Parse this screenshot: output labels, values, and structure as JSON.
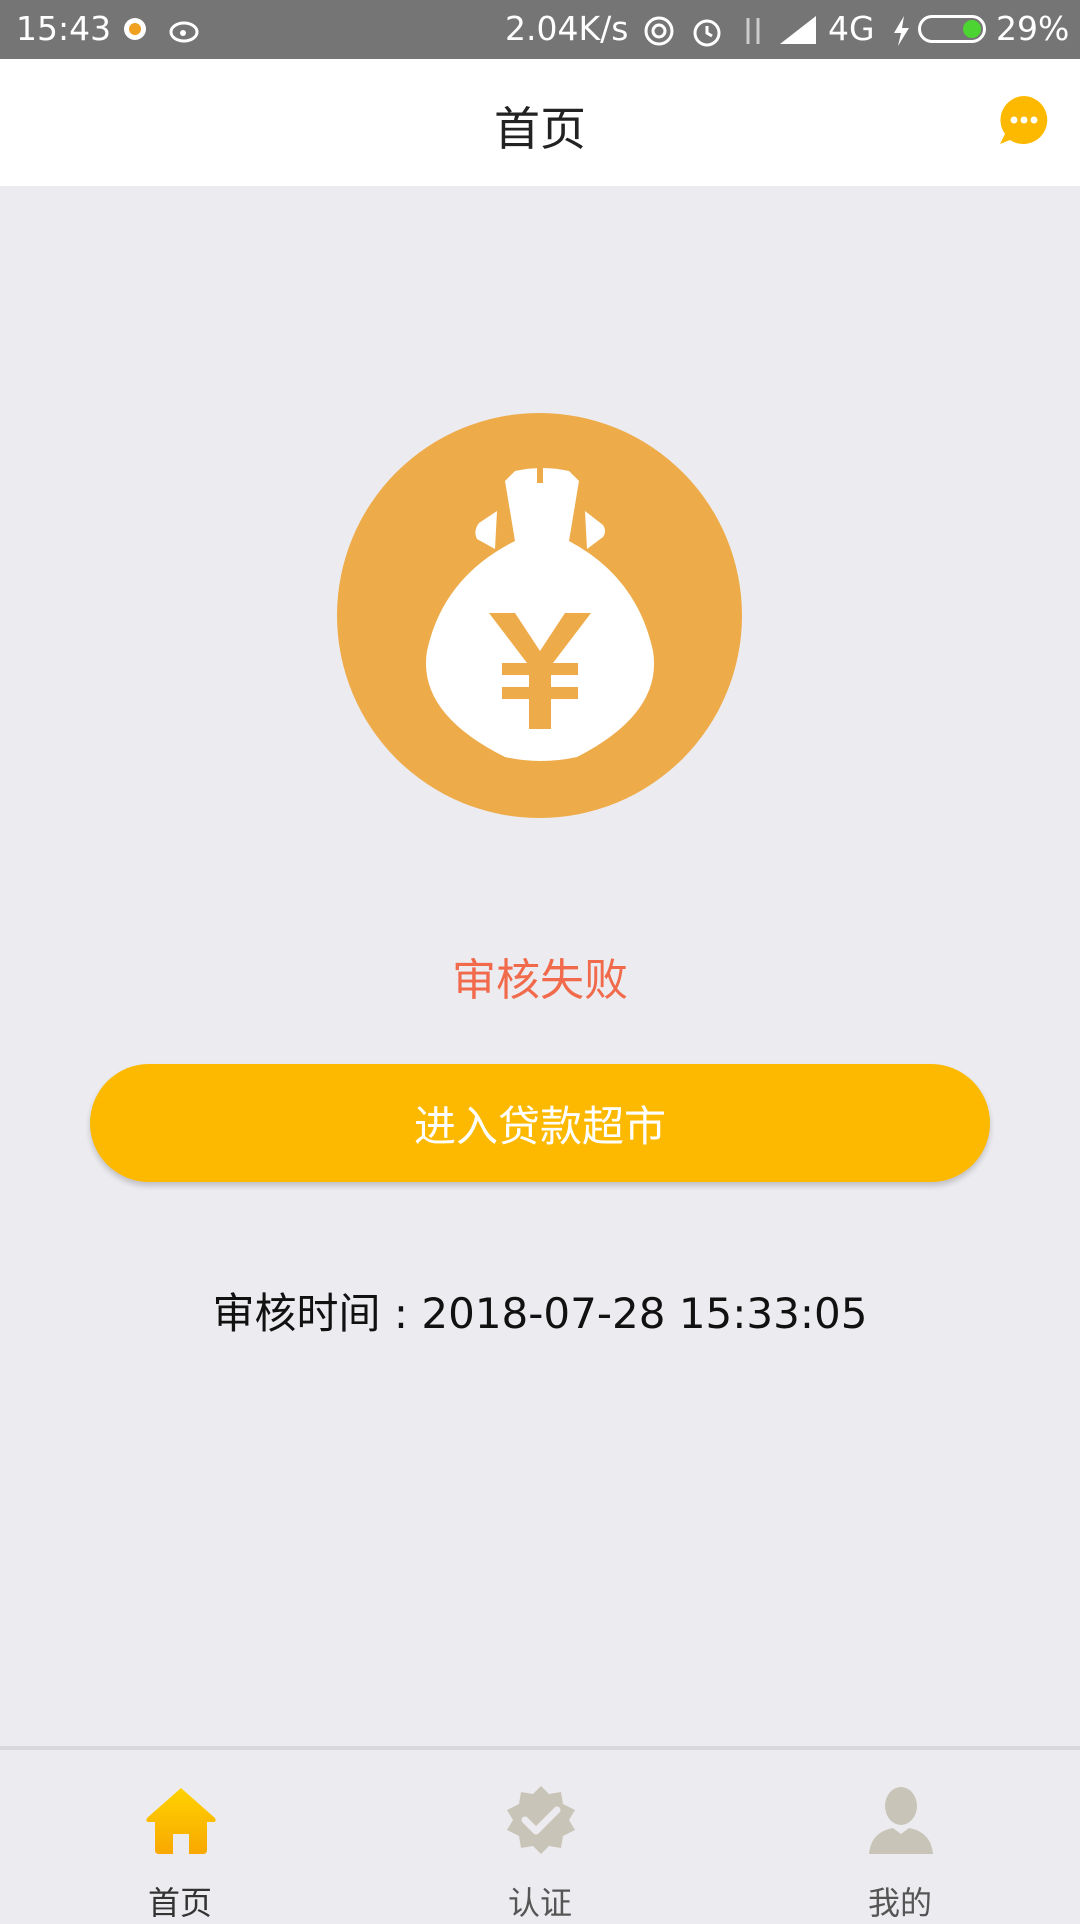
{
  "status_bar": {
    "time": "15:43",
    "net_speed": "2.04K/s",
    "network": "4G",
    "battery": "29%"
  },
  "header": {
    "title": "首页",
    "message_icon": "chat-bubble-icon"
  },
  "main": {
    "hero_icon": "money-bag-yen-icon",
    "status": "审核失败",
    "cta_label": "进入贷款超市",
    "review_time": "审核时间 : 2018-07-28 15:33:05"
  },
  "bottom_nav": {
    "items": [
      {
        "label": "首页",
        "icon": "home-icon",
        "active": true
      },
      {
        "label": "认证",
        "icon": "verified-badge-icon",
        "active": false
      },
      {
        "label": "我的",
        "icon": "user-icon",
        "active": false
      }
    ]
  },
  "colors": {
    "accent": "#fcb900",
    "circle": "#eeab4a",
    "status_fail": "#f06a4b",
    "inactive_icon": "#c9c4b8"
  }
}
